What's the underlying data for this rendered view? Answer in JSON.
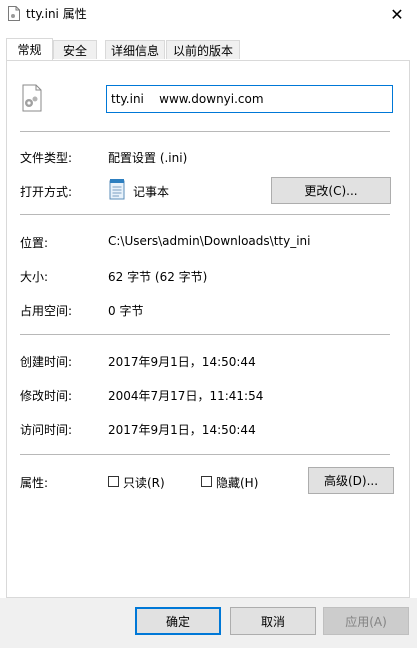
{
  "window": {
    "title": "tty.ini 属性",
    "close_glyph": "✕"
  },
  "tabs": [
    {
      "label": "常规",
      "active": true
    },
    {
      "label": "安全",
      "active": false
    },
    {
      "label": "详细信息",
      "active": false
    },
    {
      "label": "以前的版本",
      "active": false
    }
  ],
  "general": {
    "file_name": "tty.ini    www.downyi.com",
    "file_type_label": "文件类型:",
    "file_type_value": "配置设置 (.ini)",
    "opens_with_label": "打开方式:",
    "opens_with_value": "记事本",
    "change_button": "更改(C)...",
    "location_label": "位置:",
    "location_value": "C:\\Users\\admin\\Downloads\\tty_ini",
    "size_label": "大小:",
    "size_value": "62 字节 (62 字节)",
    "size_on_disk_label": "占用空间:",
    "size_on_disk_value": "0 字节",
    "created_label": "创建时间:",
    "created_value": "2017年9月1日，14:50:44",
    "modified_label": "修改时间:",
    "modified_value": "2004年7月17日，11:41:54",
    "accessed_label": "访问时间:",
    "accessed_value": "2017年9月1日，14:50:44",
    "attributes_label": "属性:",
    "readonly_label": "只读(R)",
    "hidden_label": "隐藏(H)",
    "advanced_button": "高级(D)..."
  },
  "footer": {
    "ok_button": "确定",
    "cancel_button": "取消",
    "apply_button": "应用(A)"
  },
  "colors": {
    "accent": "#0078d7",
    "separator": "#b8b8b8",
    "footer_bg": "#f0f0f0"
  }
}
